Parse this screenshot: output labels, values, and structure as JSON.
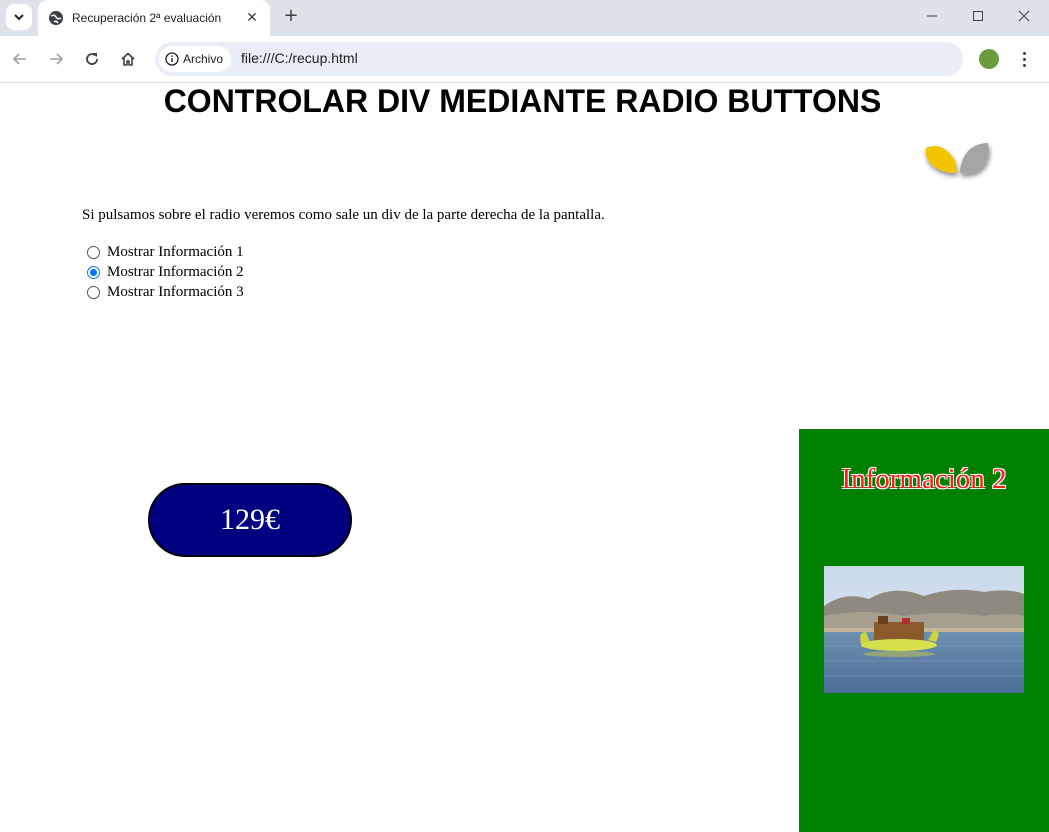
{
  "browser": {
    "tab_title": "Recuperación 2ª evaluación",
    "site_chip": "Archivo",
    "url": "file:///C:/recup.html"
  },
  "page": {
    "heading": "CONTROLAR DIV MEDIANTE RADIO BUTTONS",
    "intro": "Si pulsamos sobre el radio veremos como sale un div de la parte derecha de la pantalla.",
    "radio_options": [
      {
        "label": "Mostrar Información 1",
        "checked": false
      },
      {
        "label": "Mostrar Información 2",
        "checked": true
      },
      {
        "label": "Mostrar Información 3",
        "checked": false
      }
    ],
    "price": "129€",
    "panel": {
      "title": "Información 2",
      "bg_color": "#008000",
      "title_color": "#ff1a1a"
    }
  },
  "icons": {
    "tab_search": "chevron-down-icon",
    "favicon": "globe-icon",
    "logo": "leaves-logo-icon",
    "photo": "reed-boat-lake-photo"
  }
}
